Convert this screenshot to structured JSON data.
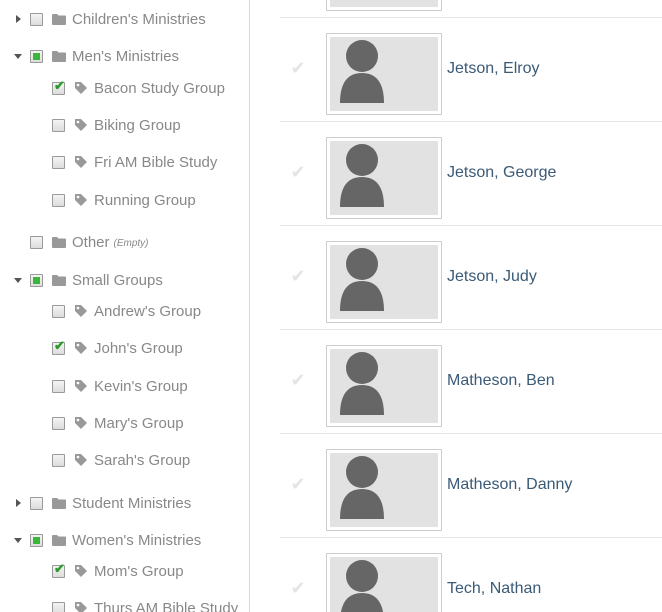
{
  "tree": [
    {
      "label": "Children's Ministries",
      "toggle": "collapsed",
      "state": "empty",
      "icon": "folder-icon"
    },
    {
      "label": "Men's Ministries",
      "toggle": "expanded",
      "state": "partial",
      "icon": "folder-icon"
    },
    {
      "label": "Bacon Study Group",
      "toggle": "none",
      "state": "checked",
      "icon": "tag-icon",
      "child": true
    },
    {
      "label": "Biking Group",
      "toggle": "none",
      "state": "empty",
      "icon": "tag-icon",
      "child": true
    },
    {
      "label": "Fri AM Bible Study",
      "toggle": "none",
      "state": "empty",
      "icon": "tag-icon",
      "child": true
    },
    {
      "label": "Running Group",
      "toggle": "none",
      "state": "empty",
      "icon": "tag-icon",
      "child": true
    },
    {
      "label": "Other",
      "note": "(Empty)",
      "toggle": "none",
      "state": "empty",
      "icon": "folder-icon"
    },
    {
      "label": "Small Groups",
      "toggle": "expanded",
      "state": "partial",
      "icon": "folder-icon"
    },
    {
      "label": "Andrew's Group",
      "toggle": "none",
      "state": "empty",
      "icon": "tag-icon",
      "child": true
    },
    {
      "label": "John's Group",
      "toggle": "none",
      "state": "checked",
      "icon": "tag-icon",
      "child": true
    },
    {
      "label": "Kevin's Group",
      "toggle": "none",
      "state": "empty",
      "icon": "tag-icon",
      "child": true
    },
    {
      "label": "Mary's Group",
      "toggle": "none",
      "state": "empty",
      "icon": "tag-icon",
      "child": true
    },
    {
      "label": "Sarah's Group",
      "toggle": "none",
      "state": "empty",
      "icon": "tag-icon",
      "child": true
    },
    {
      "label": "Student Ministries",
      "toggle": "collapsed",
      "state": "empty",
      "icon": "folder-icon"
    },
    {
      "label": "Women's Ministries",
      "toggle": "expanded",
      "state": "partial",
      "icon": "folder-icon"
    },
    {
      "label": "Mom's Group",
      "toggle": "none",
      "state": "checked",
      "icon": "tag-icon",
      "child": true
    },
    {
      "label": "Thurs AM Bible Study",
      "toggle": "none",
      "state": "empty",
      "icon": "tag-icon",
      "child": true
    }
  ],
  "people": [
    {
      "name": ""
    },
    {
      "name": "Jetson, Elroy"
    },
    {
      "name": "Jetson, George"
    },
    {
      "name": "Jetson, Judy"
    },
    {
      "name": "Matheson, Ben"
    },
    {
      "name": "Matheson, Danny"
    },
    {
      "name": "Tech, Nathan"
    }
  ],
  "colors": {
    "name_link": "#3a5a76",
    "label_gray": "#888888",
    "check_green": "#39b739"
  }
}
